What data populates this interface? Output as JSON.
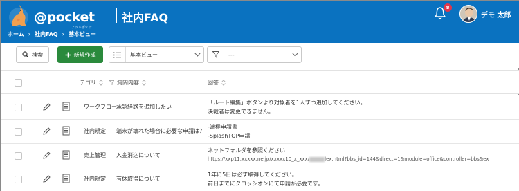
{
  "header": {
    "logo_text": "@pocket",
    "logo_sub": "アットポケット",
    "page_title": "社内FAQ",
    "notification_count": "8",
    "user_name": "デモ 太郎",
    "bg_color": "#0a72c0"
  },
  "breadcrumb": {
    "items": [
      "ホーム",
      "社内FAQ",
      "基本ビュー"
    ],
    "separator": "›"
  },
  "toolbar": {
    "search_label": "検索",
    "new_label": "新規作成",
    "view_value": "基本ビュー",
    "filter_value": "---"
  },
  "table": {
    "headers": {
      "category": "テゴリ",
      "question": "質問内容",
      "answer": "回答"
    },
    "rows": [
      {
        "category": "ワークフロー",
        "question": "承認経路を追加したい",
        "answer_lines": [
          "「ルート編集」ボタンより対象者を1人ずつ追加してください。",
          "決裁者は変更できません。"
        ]
      },
      {
        "category": "社内規定",
        "question": "端末が壊れた場合に必要な申請は？",
        "answer_lines": [
          "-端極申請書",
          "-SplashTOP申請"
        ]
      },
      {
        "category": "売上管理",
        "question": "入金消込について",
        "answer_lines": [
          "ネットフォルダを参照ください"
        ],
        "answer_url_start": "https://xxp11.xxxxx.ne.jp/xxxxx10_x_xxx/",
        "answer_url_end": "lex.html?bbs_id=144&direct=1&module=office&controller=bbs&ex"
      },
      {
        "category": "社内規定",
        "question": "有休取得について",
        "answer_lines": [
          "1年に5日は必ず取得してください。",
          "前日までにクロッシオンにて申請が必要です。"
        ]
      }
    ]
  },
  "colors": {
    "primary": "#0a72c0",
    "new_button": "#2a8a3c",
    "badge": "#e2364b"
  }
}
